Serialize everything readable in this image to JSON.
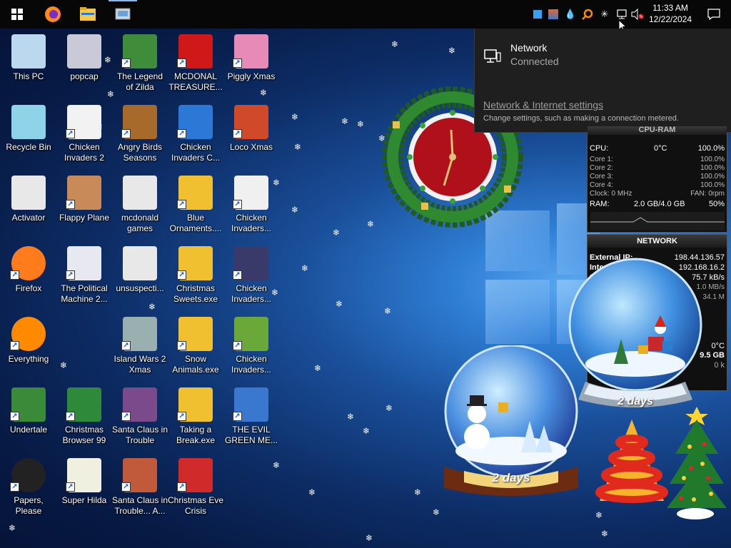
{
  "taskbar": {
    "clock_time": "11:33 AM",
    "clock_date": "12/22/2024",
    "pinned": [
      "start-icon",
      "firefox-icon",
      "file-explorer-icon",
      "control-panel-icon"
    ]
  },
  "flyout": {
    "network_name": "Network",
    "network_status": "Connected",
    "settings_link": "Network & Internet settings",
    "settings_desc": "Change settings, such as making a connection metered."
  },
  "desktop": {
    "icons": [
      {
        "label": "This PC"
      },
      {
        "label": "popcap"
      },
      {
        "label": "The Legend\nof Zilda"
      },
      {
        "label": "MCDONAL\nTREASURE..."
      },
      {
        "label": "Piggly Xmas"
      },
      {
        "label": "Recycle Bin"
      },
      {
        "label": "Chicken\nInvaders 2"
      },
      {
        "label": "Angry Birds\nSeasons"
      },
      {
        "label": "Chicken\nInvaders C..."
      },
      {
        "label": "Loco Xmas"
      },
      {
        "label": "Activator"
      },
      {
        "label": "Flappy Plane"
      },
      {
        "label": "mcdonald\ngames"
      },
      {
        "label": "Blue\nOrnaments...."
      },
      {
        "label": "Chicken\nInvaders..."
      },
      {
        "label": "Firefox"
      },
      {
        "label": "The Political\nMachine 2..."
      },
      {
        "label": "unsuspecti..."
      },
      {
        "label": "Christmas\nSweets.exe"
      },
      {
        "label": "Chicken\nInvaders..."
      },
      {
        "label": "Everything"
      },
      {
        "label": "Island Wars 2\nXmas"
      },
      {
        "label": "Snow\nAnimals.exe"
      },
      {
        "label": "Chicken\nInvaders..."
      },
      {
        "label": "Undertale"
      },
      {
        "label": "Christmas\nBrowser 99"
      },
      {
        "label": "Santa Claus in\nTrouble"
      },
      {
        "label": "Taking a\nBreak.exe"
      },
      {
        "label": "THE EVIL\nGREEN ME..."
      },
      {
        "label": "Papers, Please"
      },
      {
        "label": "Super Hilda"
      },
      {
        "label": "Santa Claus in\nTrouble... A..."
      },
      {
        "label": "Christmas Eve\nCrisis"
      }
    ]
  },
  "cpu_gadget": {
    "header": "CPU-RAM",
    "cpu_label": "CPU:",
    "cpu_temp": "0°C",
    "cpu_pct": "100.0%",
    "cores": [
      {
        "label": "Core 1:",
        "value": "100.0%"
      },
      {
        "label": "Core 2:",
        "value": "100.0%"
      },
      {
        "label": "Core 3:",
        "value": "100.0%"
      },
      {
        "label": "Core 4:",
        "value": "100.0%"
      }
    ],
    "clock": "Clock: 0 MHz",
    "fan": "FAN: 0rpm",
    "ram_label": "RAM:",
    "ram_value": "2.0 GB/4.0 GB",
    "ram_pct": "50%"
  },
  "network_gadget": {
    "header": "NETWORK",
    "external_label": "External IP:",
    "external_ip": "198.44.136.57",
    "internal_label": "Internal",
    "internal_ip": "192.168.16.2",
    "row3_label": "3",
    "row3_value": "75.7 kB/s",
    "row4_value": "1.0 MB/s",
    "row5_value": "34.1 M"
  },
  "extra_gadget": {
    "temp": "0°C",
    "value": "9.5 GB",
    "value2": "0 k"
  },
  "snowglobes": [
    {
      "label": "2 days"
    },
    {
      "label": "2 days"
    }
  ]
}
